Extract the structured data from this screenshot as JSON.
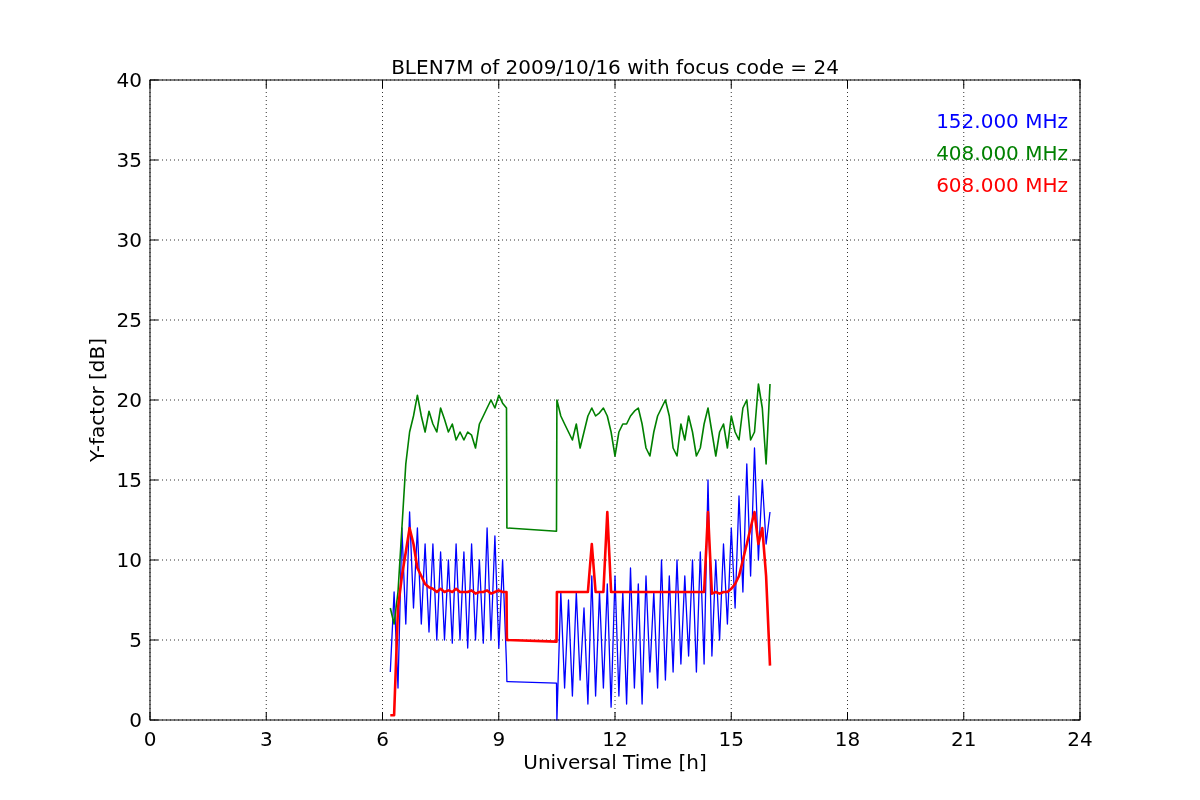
{
  "chart_data": {
    "type": "line",
    "title": "BLEN7M of 2009/10/16 with focus code = 24",
    "xlabel": "Universal Time [h]",
    "ylabel": "Y-factor [dB]",
    "x": [
      6.2,
      6.3,
      6.4,
      6.5,
      6.6,
      6.7,
      6.8,
      6.9,
      7.0,
      7.1,
      7.2,
      7.3,
      7.4,
      7.5,
      7.6,
      7.7,
      7.8,
      7.9,
      8.0,
      8.1,
      8.2,
      8.3,
      8.4,
      8.5,
      8.6,
      8.7,
      8.8,
      8.9,
      9.0,
      9.1,
      9.2,
      9.21,
      10.49,
      10.5,
      10.6,
      10.7,
      10.8,
      10.9,
      11.0,
      11.1,
      11.2,
      11.3,
      11.4,
      11.5,
      11.6,
      11.7,
      11.8,
      11.9,
      12.0,
      12.1,
      12.2,
      12.3,
      12.4,
      12.5,
      12.6,
      12.7,
      12.8,
      12.9,
      13.0,
      13.1,
      13.2,
      13.3,
      13.4,
      13.5,
      13.6,
      13.7,
      13.8,
      13.9,
      14.0,
      14.1,
      14.2,
      14.3,
      14.4,
      14.5,
      14.6,
      14.7,
      14.8,
      14.9,
      15.0,
      15.1,
      15.2,
      15.3,
      15.4,
      15.5,
      15.6,
      15.7,
      15.8,
      15.9,
      16.0
    ],
    "series": [
      {
        "name": "152.000 MHz",
        "color": "#0000ff",
        "values": [
          3,
          8,
          2,
          12,
          6,
          13,
          7,
          12,
          6,
          11,
          5.5,
          11,
          5,
          10.5,
          5,
          10,
          4.8,
          11,
          5,
          10.5,
          4.5,
          11,
          5,
          10,
          4.8,
          12,
          5,
          11.5,
          4.5,
          10,
          3.5,
          2.4,
          2.3,
          0,
          8,
          2,
          7.5,
          1.5,
          8,
          2.5,
          7,
          1,
          9,
          1.5,
          8,
          2,
          8.5,
          0.8,
          9,
          1.5,
          8,
          1,
          9.5,
          2,
          8.5,
          1,
          9,
          3,
          8,
          2,
          10,
          2.5,
          9,
          3,
          10,
          3.5,
          9,
          4,
          10,
          3,
          10.5,
          3.5,
          15,
          4,
          10,
          5,
          11,
          6,
          12,
          7,
          14,
          8,
          16,
          9,
          17,
          10,
          15,
          11,
          13
        ]
      },
      {
        "name": "408.000 MHz",
        "color": "#008000",
        "values": [
          7,
          6,
          8,
          12,
          16,
          18,
          19,
          20.3,
          19,
          18,
          19.3,
          18.5,
          18,
          19.5,
          18.8,
          18,
          18.5,
          17.5,
          18,
          17.5,
          18,
          17.8,
          17,
          18.5,
          19,
          19.5,
          20,
          19.5,
          20.3,
          19.8,
          19.5,
          12,
          11.8,
          20,
          19,
          18.5,
          18,
          17.5,
          18.5,
          17,
          18,
          19,
          19.5,
          19,
          19.2,
          19.5,
          19,
          18,
          16.5,
          18,
          18.5,
          18.5,
          19,
          19.3,
          19.5,
          18.5,
          17,
          16.5,
          18,
          19,
          19.5,
          20,
          19,
          17,
          16.5,
          18.5,
          17.5,
          19,
          18,
          16.5,
          17,
          18.5,
          19.5,
          18,
          16.5,
          18,
          18.5,
          17,
          19,
          18,
          17.5,
          19.5,
          20,
          17.5,
          18,
          21,
          19.5,
          16,
          21
        ]
      },
      {
        "name": "608.000 MHz",
        "color": "#ff0000",
        "values": [
          0.3,
          0.3,
          7,
          9,
          10.5,
          12,
          11,
          9.5,
          9,
          8.5,
          8.3,
          8.2,
          8,
          8.2,
          8,
          8.1,
          8,
          8.2,
          8,
          8,
          8,
          8.1,
          7.9,
          8,
          8,
          8.1,
          7.9,
          8,
          8.1,
          8,
          8,
          5,
          4.9,
          8,
          8,
          8,
          8,
          8,
          8,
          8,
          8,
          8,
          11,
          8,
          8,
          8,
          13,
          8,
          8,
          8,
          8,
          8,
          8,
          8,
          8,
          8,
          8,
          8,
          8,
          8,
          8,
          8,
          8,
          8,
          8,
          8,
          8,
          8,
          8,
          8,
          8,
          8,
          13,
          7.9,
          8,
          7.9,
          8,
          8,
          8.2,
          8.5,
          9,
          10,
          11,
          12,
          13,
          11,
          12,
          9,
          3.4
        ]
      }
    ],
    "xlim": [
      0,
      24
    ],
    "ylim": [
      0,
      40
    ],
    "xticks": [
      0,
      3,
      6,
      9,
      12,
      15,
      18,
      21,
      24
    ],
    "yticks": [
      0,
      5,
      10,
      15,
      20,
      25,
      30,
      35,
      40
    ],
    "grid": true
  }
}
